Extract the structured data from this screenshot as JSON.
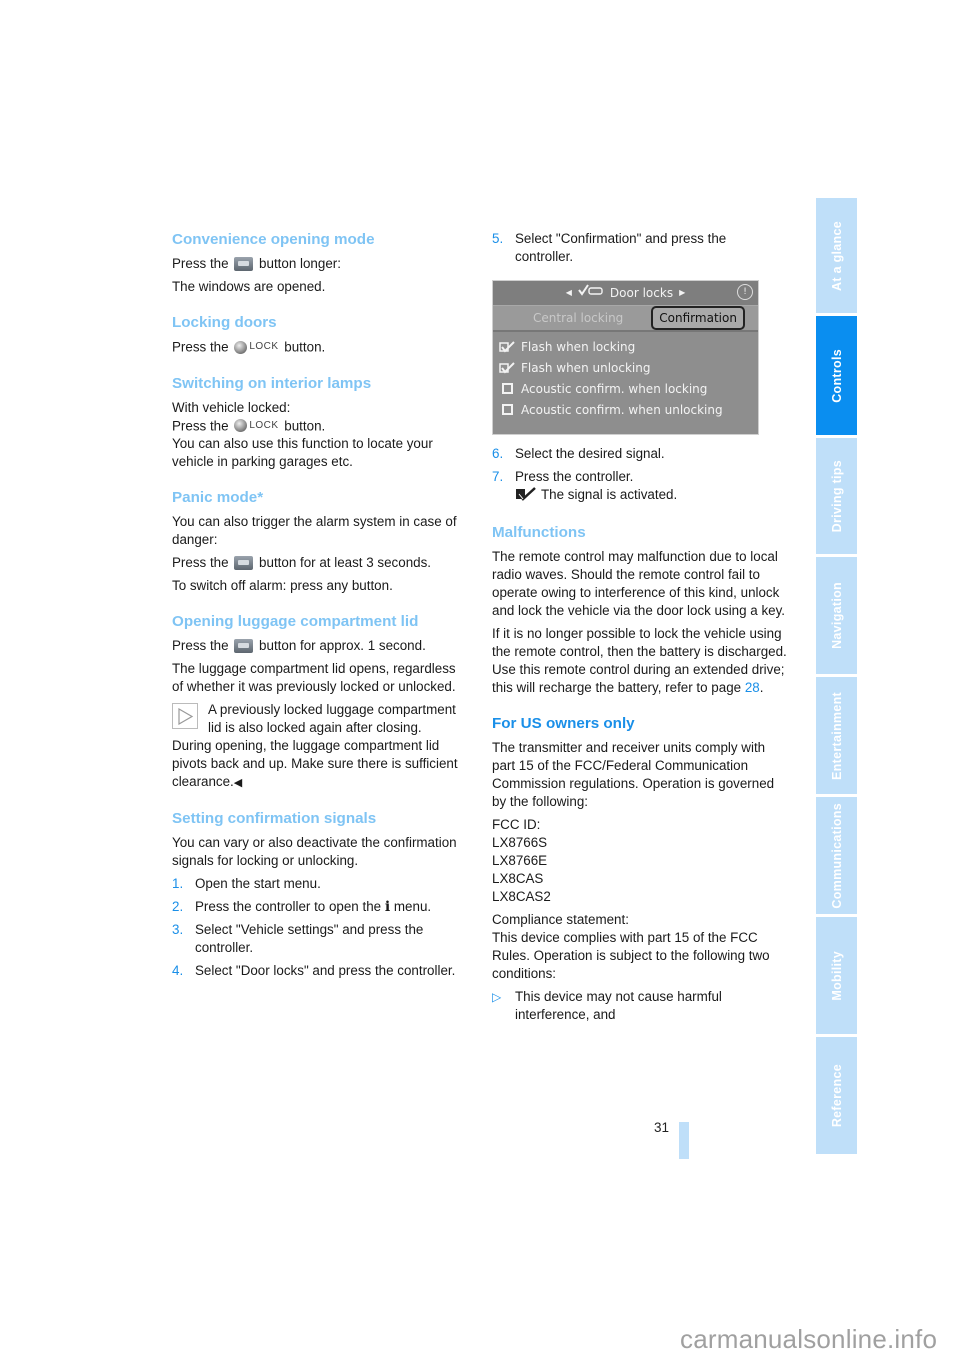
{
  "page": {
    "number": "31",
    "watermark": "carmanualsonline.info"
  },
  "sidebar": {
    "active": "Controls",
    "tabs": [
      {
        "label": "At a glance"
      },
      {
        "label": "Controls"
      },
      {
        "label": "Driving tips"
      },
      {
        "label": "Navigation"
      },
      {
        "label": "Entertainment"
      },
      {
        "label": "Communications"
      },
      {
        "label": "Mobility"
      },
      {
        "label": "Reference"
      }
    ]
  },
  "colors": {
    "heading": "#7fc4f4",
    "heading_strong": "#1a8fe8",
    "accent": "#1a8fe8",
    "tab_active": "#0a8ef0",
    "tab_inactive": "#bfdff9"
  },
  "left": {
    "convenience": {
      "heading": "Convenience opening mode",
      "p1_pre": "Press the",
      "p1_post": "button longer:",
      "p2": "The windows are opened."
    },
    "locking": {
      "heading": "Locking doors",
      "p1_pre": "Press the",
      "lock_label": "LOCK",
      "p1_post": "button."
    },
    "lamps": {
      "heading": "Switching on interior lamps",
      "l1": "With vehicle locked:",
      "l2_pre": "Press the",
      "lock_label": "LOCK",
      "l2_post": "button.",
      "l3": "You can also use this function to locate your vehicle in parking garages etc."
    },
    "panic": {
      "heading": "Panic mode*",
      "p1": "You can also trigger the alarm system in case of danger:",
      "p2_pre": "Press the",
      "p2_post": "button for at least 3 seconds.",
      "p3": "To switch off alarm: press any button."
    },
    "luggage": {
      "heading": "Opening luggage compartment lid",
      "p1_pre": "Press the",
      "p1_post": "button for approx. 1 second.",
      "p2": "The luggage compartment lid opens, regardless of whether it was previously locked or unlocked.",
      "note1": "A previously locked luggage compartment lid is also locked again after closing.",
      "note2": "During opening, the luggage compartment lid pivots back and up. Make sure there is sufficient clearance.",
      "end_mark": "◀"
    },
    "signals": {
      "heading": "Setting confirmation signals",
      "p1": "You can vary or also deactivate the confirmation signals for locking or unlocking.",
      "steps": [
        {
          "num": "1.",
          "text": "Open the start menu."
        },
        {
          "num": "2.",
          "text_pre": "Press the controller to open the",
          "text_post": "menu."
        },
        {
          "num": "3.",
          "text": "Select \"Vehicle settings\" and press the controller."
        },
        {
          "num": "4.",
          "text": "Select \"Door locks\" and press the controller."
        }
      ]
    }
  },
  "right": {
    "step5": {
      "num": "5.",
      "text": "Select \"Confirmation\" and press the controller."
    },
    "screenshot": {
      "title": "Door locks",
      "help_glyph": "!",
      "tabs": [
        "Central locking",
        "Confirmation"
      ],
      "selected_tab": "Confirmation",
      "items": [
        {
          "label": "Flash when locking",
          "checked": true
        },
        {
          "label": "Flash when unlocking",
          "checked": true
        },
        {
          "label": "Acoustic confirm. when locking",
          "checked": false
        },
        {
          "label": "Acoustic confirm. when unlocking",
          "checked": false
        }
      ]
    },
    "step6": {
      "num": "6.",
      "text": "Select the desired signal."
    },
    "step7": {
      "num": "7.",
      "text": "Press the controller.",
      "sub": "The signal is activated."
    },
    "malfunctions": {
      "heading": "Malfunctions",
      "p1": "The remote control may malfunction due to local radio waves. Should the remote control fail to operate owing to interference of this kind, unlock and lock the vehicle via the door lock using a key.",
      "p2_pre": "If it is no longer possible to lock the vehicle using the remote control, then the battery is discharged. Use this remote control during an extended drive; this will recharge the battery, refer to page",
      "p2_link": "28",
      "p2_post": "."
    },
    "us_owners": {
      "heading": "For US owners only",
      "p1": "The transmitter and receiver units comply with part 15 of the FCC/Federal Communication Commission regulations. Operation is governed by the following:",
      "fcc_label": "FCC ID:",
      "fcc_ids": [
        "LX8766S",
        "LX8766E",
        "LX8CAS",
        "LX8CAS2"
      ],
      "compliance_label": "Compliance statement:",
      "compliance_text": "This device complies with part 15 of the FCC Rules. Operation is subject to the following two conditions:",
      "bullets": [
        {
          "marker": "▷",
          "text": "This device may not cause harmful interference, and"
        }
      ]
    }
  }
}
